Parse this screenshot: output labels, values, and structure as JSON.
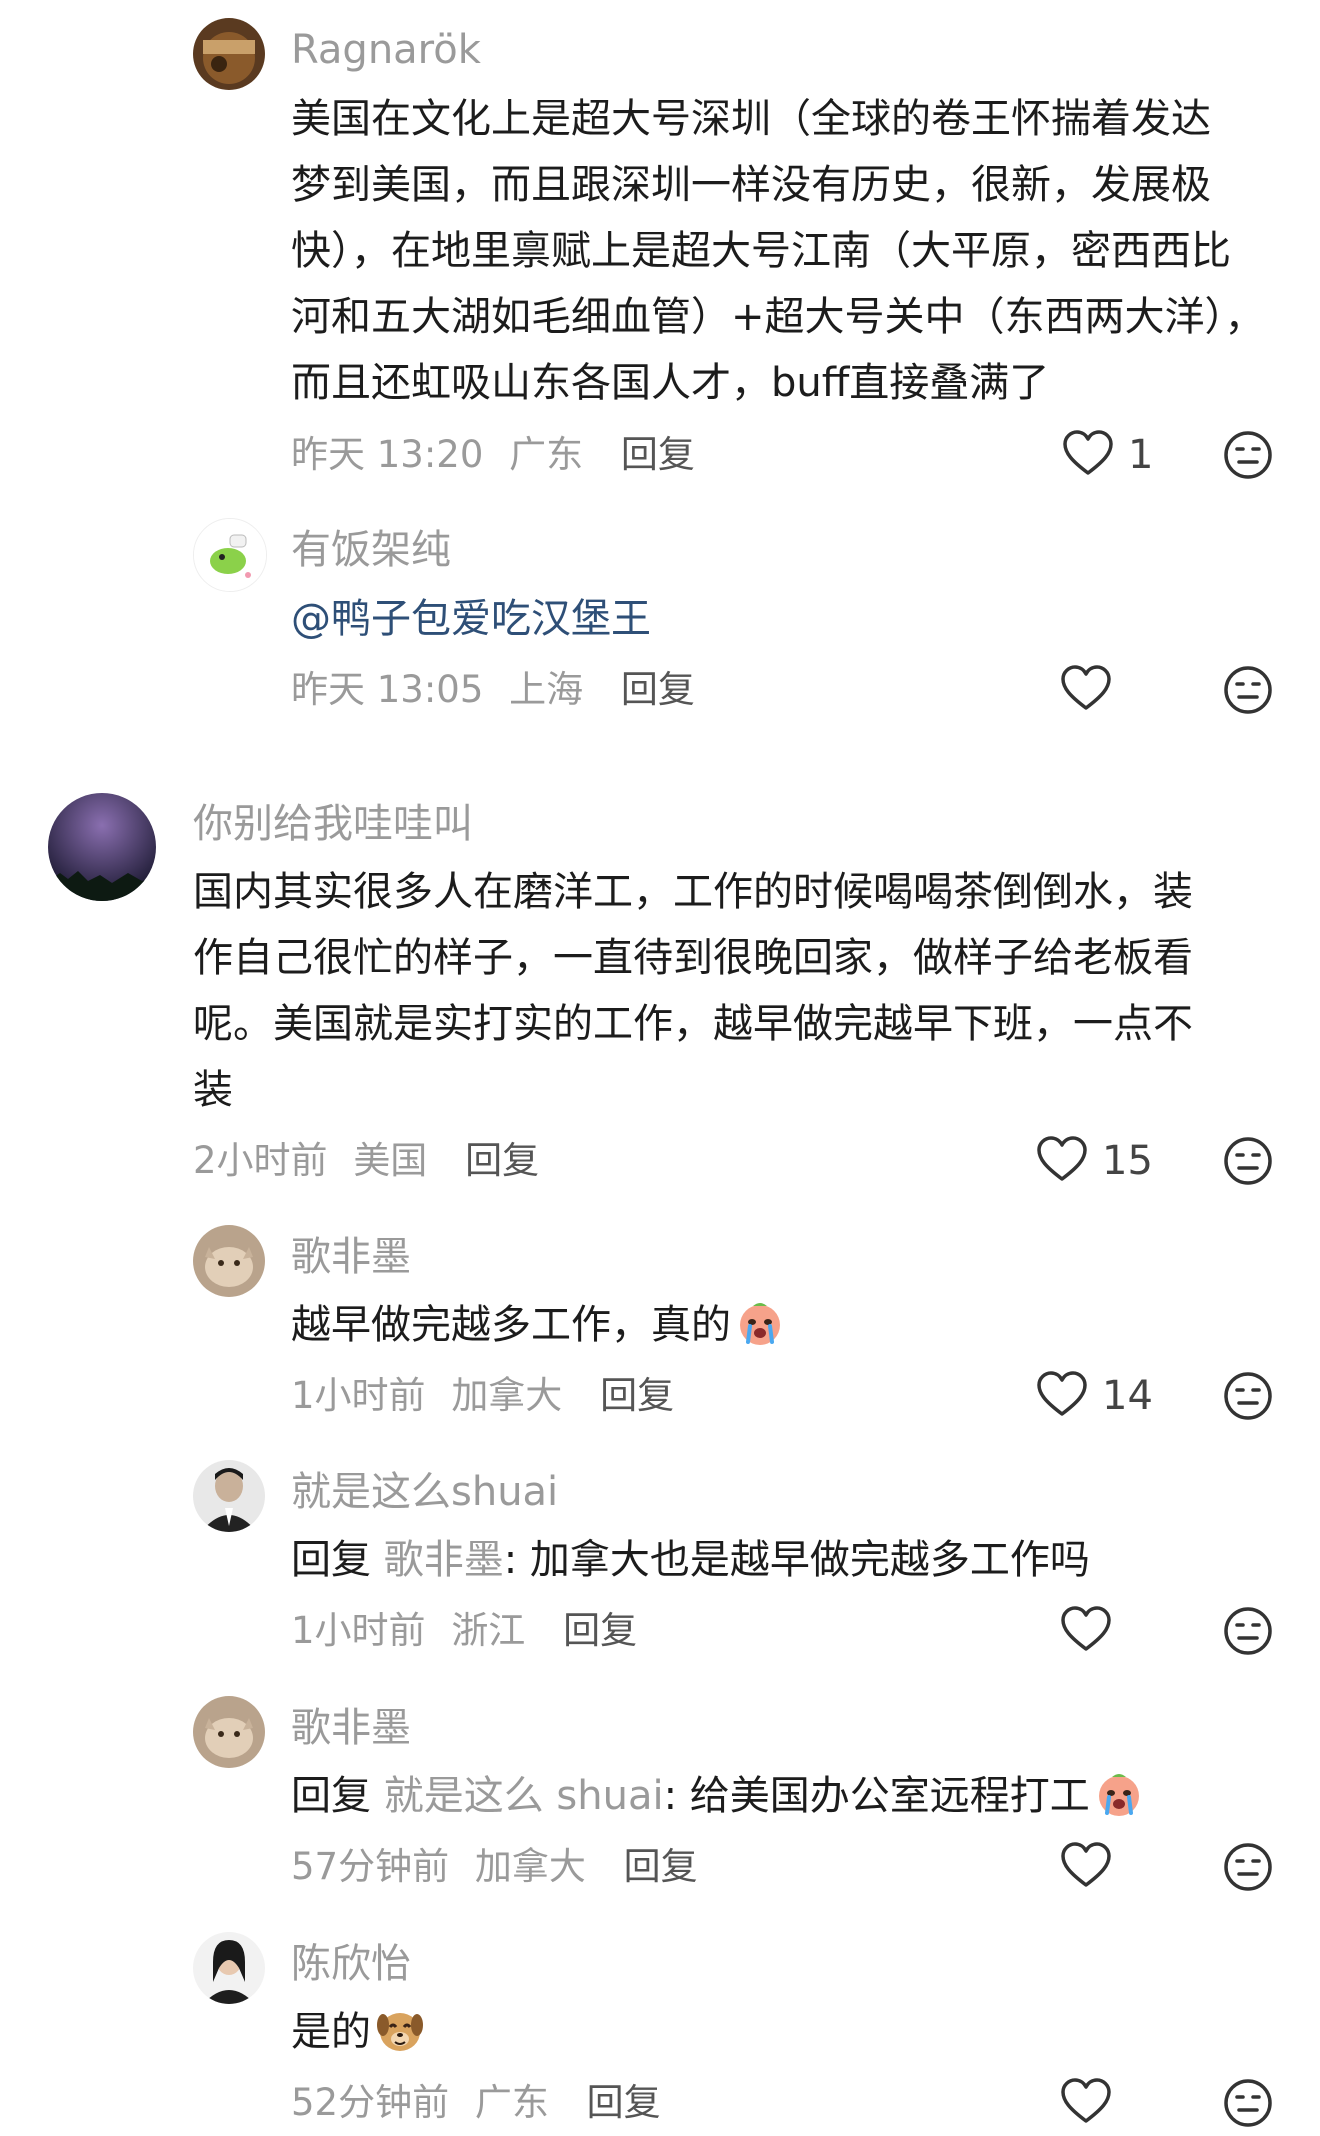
{
  "comments": [
    {
      "username": "Ragnarök",
      "lines": [
        "美国在文化上是超大号深圳（全球的卷王怀揣着发达",
        "梦到美国，而且跟深圳一样没有历史，很新，发展极",
        "快），在地里禀赋上是超大号江南（大平原，密西西比",
        "河和五大湖如毛细血管）+超大号关中（东西两大洋），",
        "而且还虹吸山东各国人才，buff直接叠满了"
      ],
      "time": "昨天 13:20",
      "location": "广东",
      "reply_label": "回复",
      "likes": "1"
    },
    {
      "username": "有饭架纯",
      "mention": "@鸭子包爱吃汉堡王",
      "time": "昨天 13:05",
      "location": "上海",
      "reply_label": "回复",
      "likes": ""
    },
    {
      "username": "你别给我哇哇叫",
      "lines": [
        "国内其实很多人在磨洋工，工作的时候喝喝茶倒倒水，装",
        "作自己很忙的样子，一直待到很晚回家，做样子给老板看",
        "呢。美国就是实打实的工作，越早做完越早下班，一点不",
        "装"
      ],
      "time": "2小时前",
      "location": "美国",
      "reply_label": "回复",
      "likes": "15"
    },
    {
      "username": "歌非墨",
      "text": "越早做完越多工作，真的",
      "emoji": "crying-face-emoji",
      "time": "1小时前",
      "location": "加拿大",
      "reply_label": "回复",
      "likes": "14"
    },
    {
      "username": "就是这么shuai",
      "reply_prefix": "回复",
      "reply_to": "歌非墨",
      "text": ": 加拿大也是越早做完越多工作吗",
      "time": "1小时前",
      "location": "浙江",
      "reply_label": "回复",
      "likes": ""
    },
    {
      "username": "歌非墨",
      "reply_prefix": "回复",
      "reply_to": "就是这么 shuai",
      "text": ": 给美国办公室远程打工",
      "emoji": "crying-face-emoji",
      "time": "57分钟前",
      "location": "加拿大",
      "reply_label": "回复",
      "likes": ""
    },
    {
      "username": "陈欣怡",
      "text": "是的",
      "emoji": "dog-laughing-emoji",
      "time": "52分钟前",
      "location": "广东",
      "reply_label": "回复",
      "likes": ""
    }
  ],
  "icons": {
    "like": "heart-outline-icon",
    "emote": "neutral-face-icon"
  },
  "colors": {
    "username": "#9a9a9a",
    "body_text": "#1c1c1c",
    "mention": "#2e4f77",
    "meta": "#9a9a9a"
  }
}
